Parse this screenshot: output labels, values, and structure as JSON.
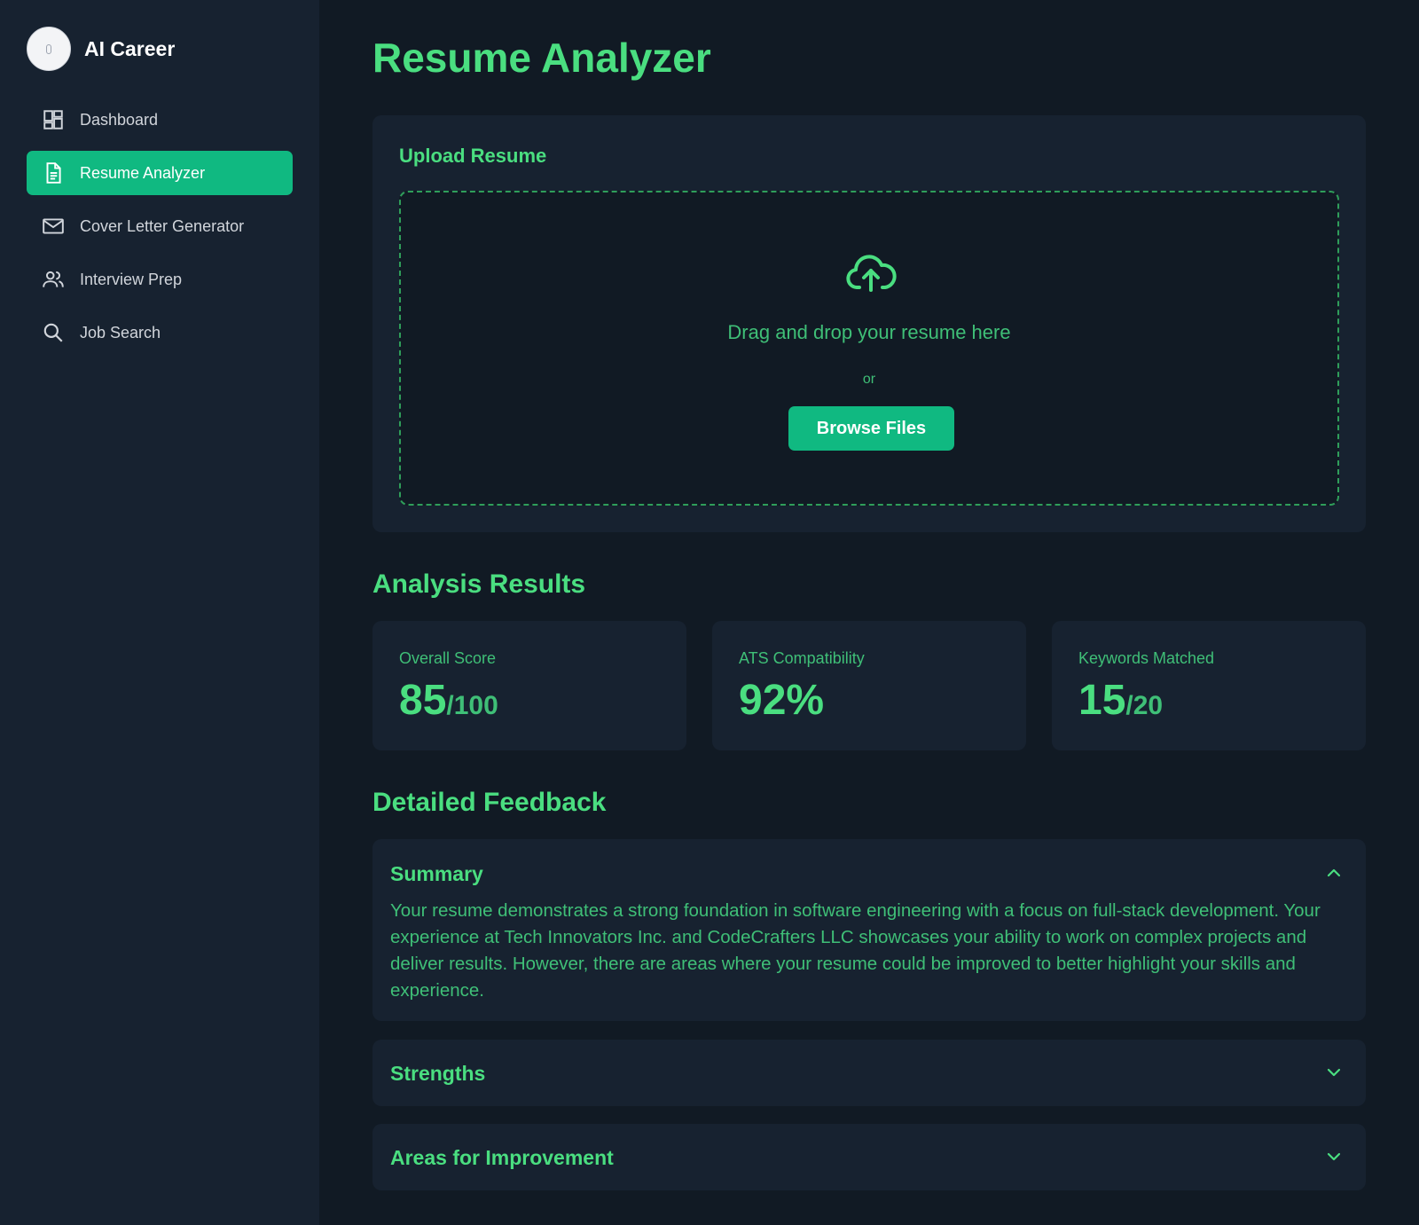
{
  "app": {
    "name": "AI Career"
  },
  "sidebar": {
    "items": [
      {
        "label": "Dashboard",
        "icon": "dashboard-icon",
        "active": false
      },
      {
        "label": "Resume Analyzer",
        "icon": "document-icon",
        "active": true
      },
      {
        "label": "Cover Letter Generator",
        "icon": "mail-icon",
        "active": false
      },
      {
        "label": "Interview Prep",
        "icon": "people-icon",
        "active": false
      },
      {
        "label": "Job Search",
        "icon": "search-icon",
        "active": false
      }
    ]
  },
  "page": {
    "title": "Resume Analyzer"
  },
  "upload": {
    "title": "Upload Resume",
    "drop_text": "Drag and drop your resume here",
    "or_text": "or",
    "browse_label": "Browse Files",
    "icon": "cloud-upload-icon"
  },
  "analysis": {
    "title": "Analysis Results",
    "stats": [
      {
        "label": "Overall Score",
        "value": "85",
        "suffix": "/100"
      },
      {
        "label": "ATS Compatibility",
        "value": "92%",
        "suffix": ""
      },
      {
        "label": "Keywords Matched",
        "value": "15",
        "suffix": "/20"
      }
    ]
  },
  "feedback": {
    "title": "Detailed Feedback",
    "sections": [
      {
        "title": "Summary",
        "expanded": true,
        "body": "Your resume demonstrates a strong foundation in software engineering with a focus on full-stack development. Your experience at Tech Innovators Inc. and CodeCrafters LLC showcases your ability to work on complex projects and deliver results. However, there are areas where your resume could be improved to better highlight your skills and experience."
      },
      {
        "title": "Strengths",
        "expanded": false,
        "body": ""
      },
      {
        "title": "Areas for Improvement",
        "expanded": false,
        "body": ""
      }
    ]
  },
  "colors": {
    "accent": "#10b981",
    "text_green": "#4ade80",
    "background": "#111a24",
    "panel": "#172230"
  }
}
